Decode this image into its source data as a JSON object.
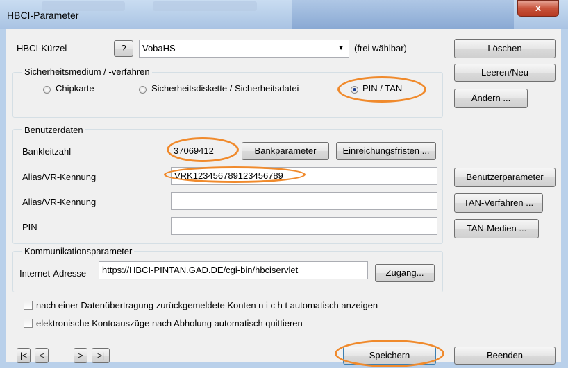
{
  "window": {
    "title": "HBCI-Parameter",
    "close_label": "x"
  },
  "hbci": {
    "kuerzel_label": "HBCI-Kürzel",
    "help_label": "?",
    "kuerzel_value": "VobaHS",
    "free_label": "(frei wählbar)"
  },
  "security": {
    "legend": "Sicherheitsmedium / -verfahren",
    "options": [
      "Chipkarte",
      "Sicherheitsdiskette / Sicherheitsdatei",
      "PIN / TAN"
    ],
    "selected": "PIN / TAN"
  },
  "user": {
    "legend": "Benutzerdaten",
    "blz_label": "Bankleitzahl",
    "blz_value": "37069412",
    "bankparam_button": "Bankparameter",
    "einreich_button": "Einreichungsfristen ...",
    "alias1_label": "Alias/VR-Kennung",
    "alias1_value": "VRK12345678912345678​9",
    "alias2_label": "Alias/VR-Kennung",
    "alias2_value": "",
    "pin_label": "PIN",
    "pin_value": ""
  },
  "comm": {
    "legend": "Kommunikationsparameter",
    "url_label": "Internet-Adresse",
    "url_value": "https://HBCI-PINTAN.GAD.DE/cgi-bin/hbciservlet",
    "zugang_button": "Zugang..."
  },
  "checks": {
    "c1": "nach einer Datenübertragung zurückgemeldete Konten  n i c h t  automatisch anzeigen",
    "c2": "elektronische Kontoauszüge nach Abholung automatisch quittieren"
  },
  "side_buttons": {
    "loeschen": "Löschen",
    "leeren": "Leeren/Neu",
    "aendern": "Ändern ...",
    "benutzerparam": "Benutzerparameter",
    "tan_verfahren": "TAN-Verfahren ...",
    "tan_medien": "TAN-Medien ..."
  },
  "nav": {
    "first": "|<",
    "prev": "<",
    "next": ">",
    "last": ">|"
  },
  "footer": {
    "save": "Speichern",
    "exit": "Beenden"
  },
  "colors": {
    "highlight": "#f08a2c",
    "titlebar": "#b9d0ea"
  }
}
